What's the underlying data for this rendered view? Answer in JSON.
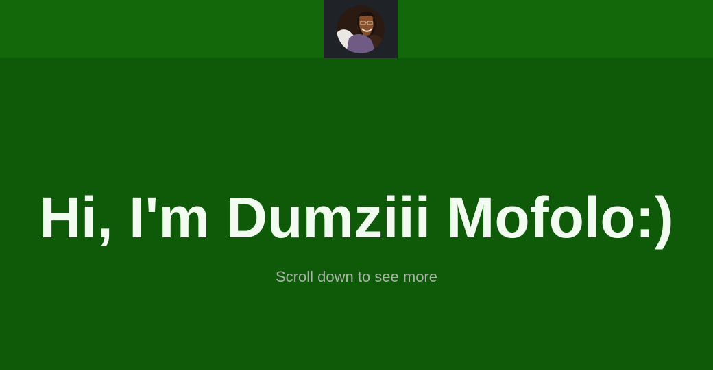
{
  "header": {
    "avatar_icon": "profile-photo"
  },
  "hero": {
    "title": "Hi, I'm Dumziii Mofolo:)",
    "subtitle": "Scroll down to see more"
  },
  "colors": {
    "header_background": "#13680a",
    "page_background": "#0f5a09",
    "avatar_frame": "#1f2226",
    "title_text": "#f1fbf0",
    "subtitle_text": "#a9b3a8"
  }
}
